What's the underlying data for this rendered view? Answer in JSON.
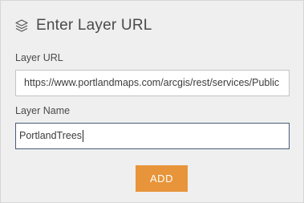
{
  "dialog": {
    "title": "Enter Layer URL",
    "title_icon": "layers-icon"
  },
  "layer_url": {
    "label": "Layer URL",
    "value": "https://www.portlandmaps.com/arcgis/rest/services/Public"
  },
  "layer_name": {
    "label": "Layer Name",
    "value": "PortlandTrees"
  },
  "actions": {
    "add_label": "ADD"
  },
  "colors": {
    "panel_background": "#efefef",
    "add_button": "#e8943a",
    "focused_border": "#4a5a78"
  }
}
